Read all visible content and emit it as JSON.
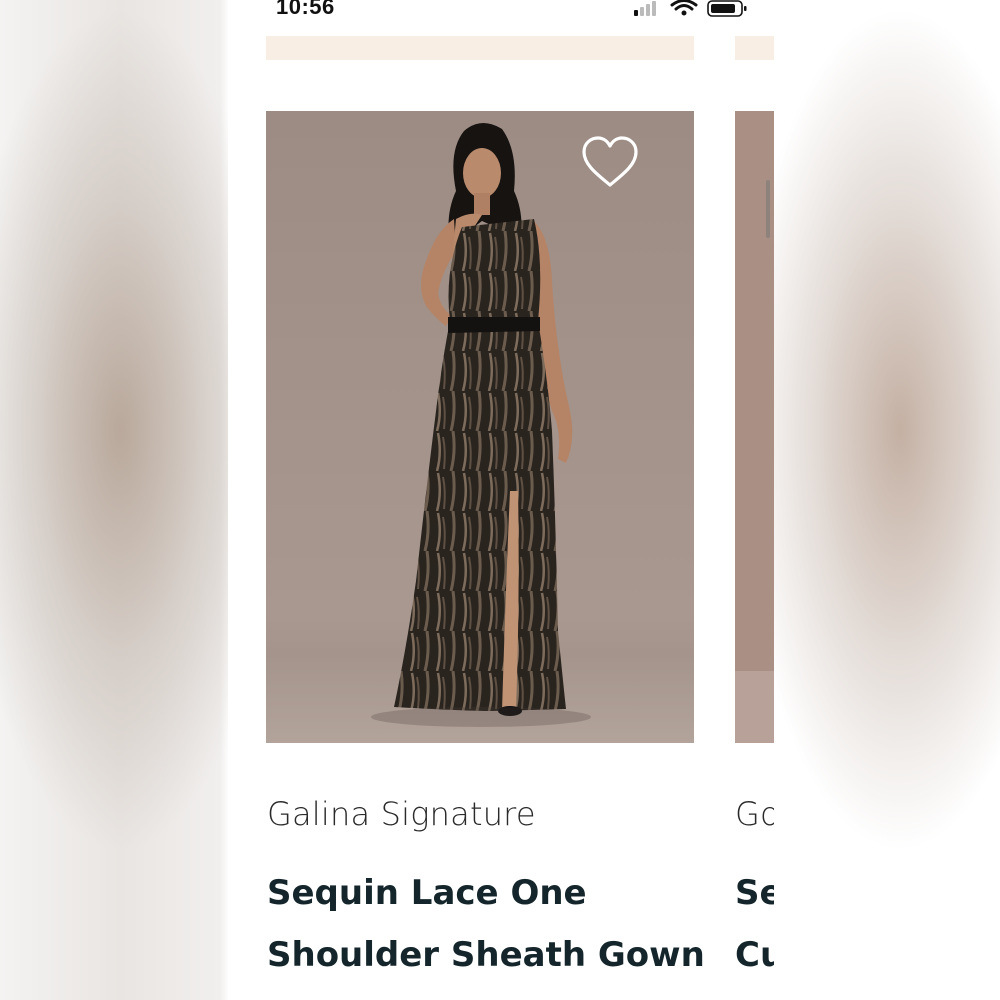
{
  "status_bar": {
    "time": "10:56",
    "icons": [
      "cellular-signal-icon",
      "wifi-icon",
      "battery-icon"
    ]
  },
  "colors": {
    "promo_strip": "#f8eee4",
    "photo_background": "#9e8e86",
    "gown": "#141210",
    "title_text": "#14262b"
  },
  "products": [
    {
      "brand": "Galina Signature",
      "name_line1": "Sequin Lace One",
      "name_line2": "Shoulder Sheath Gown",
      "favorite_icon": "heart-outline-icon"
    },
    {
      "brand": "Go",
      "name_line1": "Se",
      "name_line2": "Cu"
    }
  ]
}
